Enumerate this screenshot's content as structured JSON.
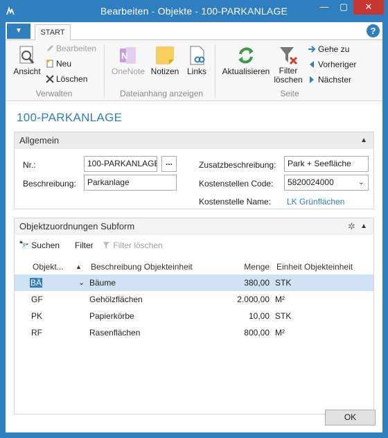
{
  "window": {
    "title": "Bearbeiten - Objekte - 100-PARKANLAGE",
    "min_glyph": "—",
    "max_glyph": "▢",
    "close_glyph": "✕"
  },
  "ribbon": {
    "app_menu_glyph": "▼",
    "tab_start": "START",
    "help_glyph": "?",
    "verwalten": {
      "ansicht": "Ansicht",
      "bearbeiten": "Bearbeiten",
      "neu": "Neu",
      "loeschen": "Löschen",
      "group": "Verwalten"
    },
    "dateianhang": {
      "onenote": "OneNote",
      "notizen": "Notizen",
      "links": "Links",
      "group": "Dateianhang anzeigen"
    },
    "seite": {
      "aktualisieren": "Aktualisieren",
      "filter_loeschen_1": "Filter",
      "filter_loeschen_2": "löschen",
      "gehe_zu": "Gehe zu",
      "vorheriger": "Vorheriger",
      "naechster": "Nächster",
      "group": "Seite"
    }
  },
  "page_title": "100-PARKANLAGE",
  "allgemein": {
    "header": "Allgemein",
    "nr_label": "Nr.:",
    "nr_value": "100-PARKANLAGE",
    "assist_glyph": "...",
    "beschreibung_label": "Beschreibung:",
    "beschreibung_value": "Parkanlage",
    "zusatz_label": "Zusatzbeschreibung:",
    "zusatz_value": "Park + Seefläche",
    "kostenstellen_code_label": "Kostenstellen Code:",
    "kostenstellen_code_value": "5820024000",
    "kostenstelle_name_label": "Kostenstelle Name:",
    "kostenstelle_name_value": "LK Grünflächen"
  },
  "subform": {
    "header": "Objektzuordnungen Subform",
    "suchen": "Suchen",
    "filter": "Filter",
    "filter_loeschen": "Filter löschen",
    "columns": {
      "code": "Objekt...",
      "sort_glyph": "▲",
      "beschreibung": "Beschreibung Objekteinheit",
      "menge": "Menge",
      "einheit": "Einheit Objekteinheit"
    },
    "rows": [
      {
        "code": "BÄ",
        "beschreibung": "Bäume",
        "menge": "380,00",
        "einheit": "STK"
      },
      {
        "code": "GF",
        "beschreibung": "Gehölzflächen",
        "menge": "2.000,00",
        "einheit": "M²"
      },
      {
        "code": "PK",
        "beschreibung": "Papierkörbe",
        "menge": "10,00",
        "einheit": "STK"
      },
      {
        "code": "RF",
        "beschreibung": "Rasenflächen",
        "menge": "800,00",
        "einheit": "M²"
      }
    ]
  },
  "ok": "OK",
  "colors": {
    "accent": "#2f7fbf",
    "selected_row": "#cfe3f5",
    "close": "#c7372f"
  }
}
